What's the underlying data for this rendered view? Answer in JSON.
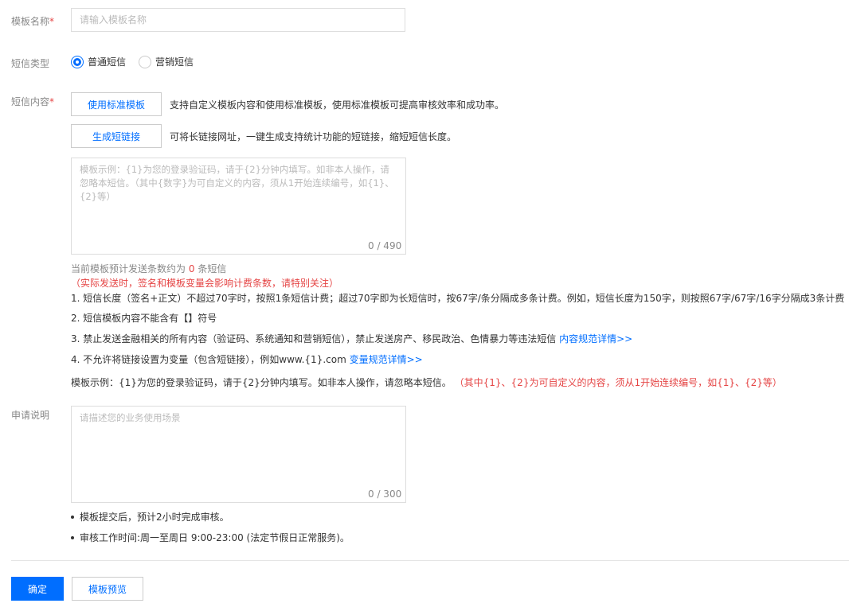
{
  "form": {
    "name": {
      "label": "模板名称",
      "required_mark": "*",
      "placeholder": "请输入模板名称",
      "value": ""
    },
    "type": {
      "label": "短信类型",
      "options": [
        {
          "label": "普通短信",
          "checked": true
        },
        {
          "label": "营销短信",
          "checked": false
        }
      ]
    },
    "content": {
      "label": "短信内容",
      "required_mark": "*",
      "standard_template_button": "使用标准模板",
      "standard_template_desc": "支持自定义模板内容和使用标准模板，使用标准模板可提高审核效率和成功率。",
      "short_link_button": "生成短链接",
      "short_link_desc": "可将长链接网址，一键生成支持统计功能的短链接，缩短短信长度。",
      "placeholder": "模板示例：{1}为您的登录验证码，请于{2}分钟内填写。如非本人操作，请忽略本短信。（其中{数字}为可自定义的内容，须从1开始连续编号，如{1}、{2}等）",
      "value": "",
      "counter": "0 / 490",
      "estimate_prefix": "当前模板预计发送条数约为",
      "estimate_count": "0",
      "estimate_suffix": "条短信",
      "estimate_note": "（实际发送时，签名和模板变量会影响计费条数，请特别关注）",
      "rules": {
        "r1": "1. 短信长度（签名+正文）不超过70字时，按照1条短信计费；超过70字即为长短信时，按67字/条分隔成多条计费。例如，短信长度为150字，则按照67字/67字/16字分隔成3条计费",
        "r2": "2. 短信模板内容不能含有【】符号",
        "r3_text": "3. 禁止发送金融相关的所有内容（验证码、系统通知和营销短信），禁止发送房产、移民政治、色情暴力等违法短信",
        "r3_link": "内容规范详情>>",
        "r4_text": "4. 不允许将链接设置为变量（包含短链接），例如www.{1}.com",
        "r4_link": "变量规范详情>>"
      },
      "example_text": "模板示例：{1}为您的登录验证码，请于{2}分钟内填写。如非本人操作，请忽略本短信。",
      "example_note": "（其中{1}、{2}为可自定义的内容，须从1开始连续编号，如{1}、{2}等）"
    },
    "application": {
      "label": "申请说明",
      "placeholder": "请描述您的业务使用场景",
      "value": "",
      "counter": "0 / 300",
      "notes": [
        "模板提交后，预计2小时完成审核。",
        "审核工作时间:周一至周日 9:00-23:00 (法定节假日正常服务)。"
      ]
    }
  },
  "actions": {
    "confirm": "确定",
    "preview": "模板预览"
  },
  "colors": {
    "primary": "#006eff",
    "required": "#e54545",
    "label": "#888888"
  }
}
